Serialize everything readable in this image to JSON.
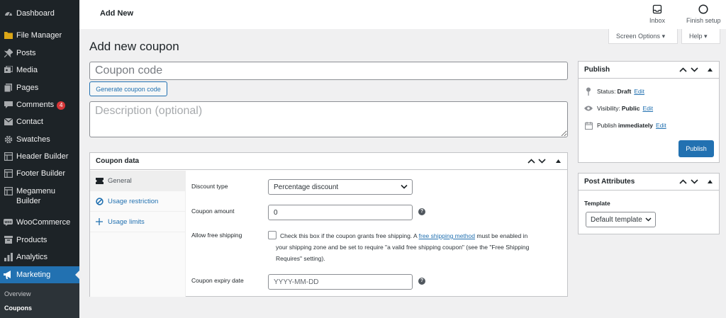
{
  "sidebar": {
    "items": [
      {
        "label": "Dashboard",
        "icon": "dashboard-icon"
      },
      {
        "label": "File Manager",
        "icon": "folder-icon"
      },
      {
        "label": "Posts",
        "icon": "pin-icon"
      },
      {
        "label": "Media",
        "icon": "media-icon"
      },
      {
        "label": "Pages",
        "icon": "pages-icon"
      },
      {
        "label": "Comments",
        "icon": "comment-icon",
        "badge": "4"
      },
      {
        "label": "Contact",
        "icon": "mail-icon"
      },
      {
        "label": "Swatches",
        "icon": "gear-icon"
      },
      {
        "label": "Header Builder",
        "icon": "builder-icon"
      },
      {
        "label": "Footer Builder",
        "icon": "builder-icon"
      },
      {
        "label": "Megamenu Builder",
        "icon": "builder-icon"
      },
      {
        "label": "WooCommerce",
        "icon": "woo-icon"
      },
      {
        "label": "Products",
        "icon": "archive-icon"
      },
      {
        "label": "Analytics",
        "icon": "bar-chart-icon"
      },
      {
        "label": "Marketing",
        "icon": "megaphone-icon"
      }
    ],
    "submenu": [
      "Overview",
      "Coupons"
    ]
  },
  "topbar": {
    "title": "Add New",
    "inbox_label": "Inbox",
    "finish_setup_label": "Finish setup"
  },
  "screen_options_label": "Screen Options",
  "help_label": "Help",
  "page_heading": "Add new coupon",
  "coupon_code_placeholder": "Coupon code",
  "generate_button_label": "Generate coupon code",
  "description_placeholder": "Description (optional)",
  "coupon_data": {
    "title": "Coupon data",
    "tabs": [
      "General",
      "Usage restriction",
      "Usage limits"
    ],
    "fields": {
      "discount_type_label": "Discount type",
      "discount_type_value": "Percentage discount",
      "coupon_amount_label": "Coupon amount",
      "coupon_amount_value": "0",
      "free_shipping_label": "Allow free shipping",
      "free_shipping_desc_1a": "Check this box if the coupon grants free shipping. A ",
      "free_shipping_link": "free shipping method",
      "free_shipping_desc_1b": " must be enabled in",
      "free_shipping_desc_2": "your shipping zone and be set to require \"a valid free shipping coupon\" (see the \"Free Shipping",
      "free_shipping_desc_3": "Requires\" setting).",
      "expiry_label": "Coupon expiry date",
      "expiry_placeholder": "YYYY-MM-DD"
    }
  },
  "publish": {
    "title": "Publish",
    "status_label": "Status:",
    "status_value": "Draft",
    "visibility_label": "Visibility:",
    "visibility_value": "Public",
    "publish_label": "Publish",
    "publish_value": "immediately",
    "edit_label": "Edit",
    "button_label": "Publish"
  },
  "post_attributes": {
    "title": "Post Attributes",
    "template_label": "Template",
    "template_value": "Default template"
  },
  "colors": {
    "sidebar_bg": "#1d2327",
    "accent": "#2271b1",
    "badge": "#d63638"
  }
}
